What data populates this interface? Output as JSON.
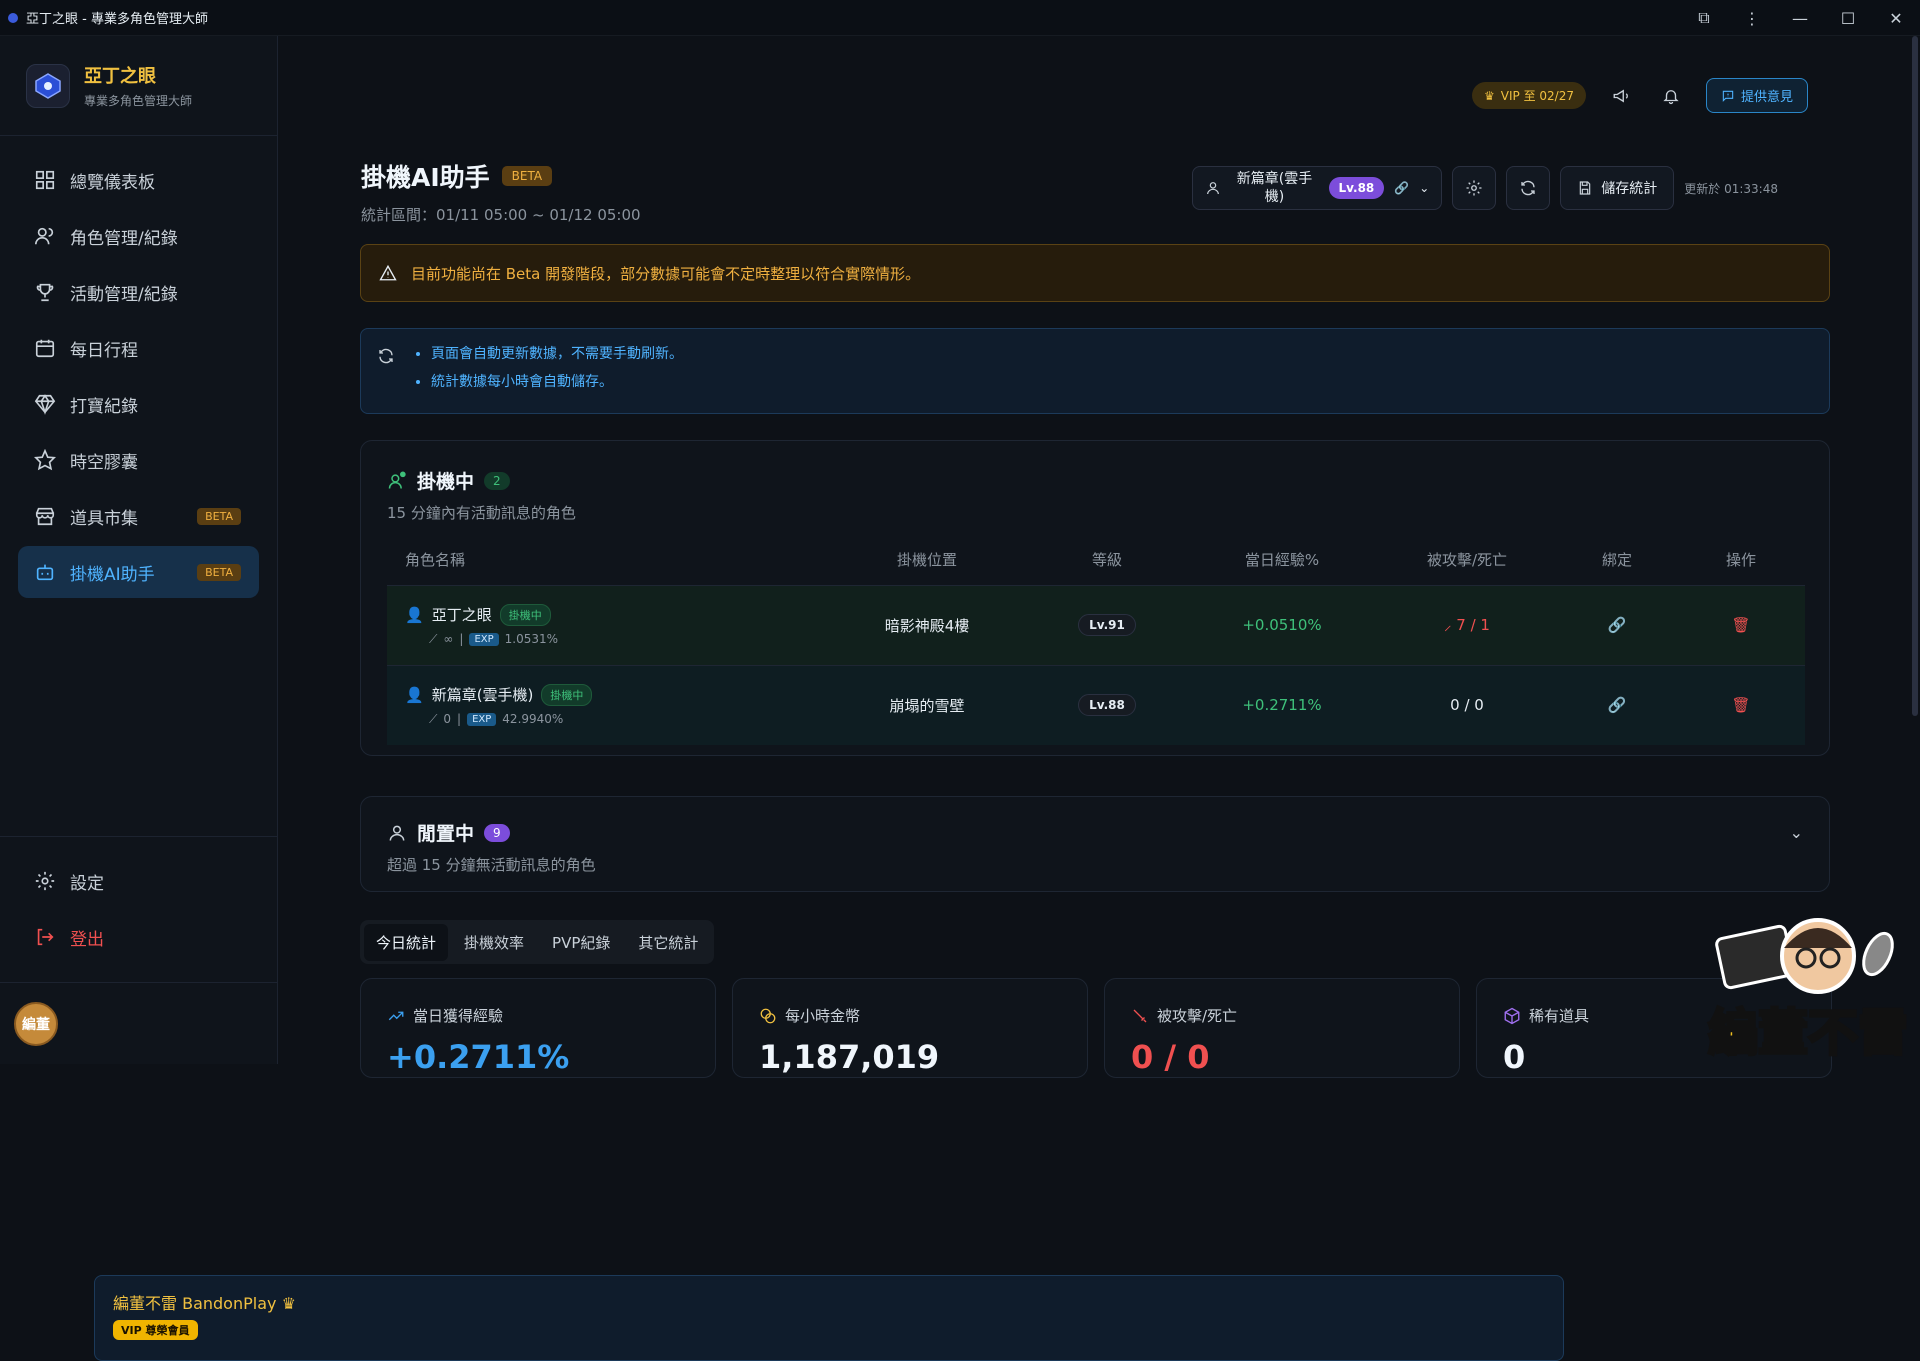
{
  "window": {
    "title": "亞丁之眼 - 專業多角色管理大師"
  },
  "brand": {
    "name": "亞丁之眼",
    "subtitle": "專業多角色管理大師"
  },
  "sidebar": {
    "items": [
      {
        "label": "總覽儀表板",
        "icon": "dashboard-icon"
      },
      {
        "label": "角色管理/紀錄",
        "icon": "users-icon"
      },
      {
        "label": "活動管理/紀錄",
        "icon": "trophy-icon"
      },
      {
        "label": "每日行程",
        "icon": "calendar-icon"
      },
      {
        "label": "打寶紀錄",
        "icon": "gem-icon"
      },
      {
        "label": "時空膠囊",
        "icon": "star-icon"
      },
      {
        "label": "道具市集",
        "icon": "store-icon",
        "badge": "BETA"
      },
      {
        "label": "掛機AI助手",
        "icon": "bot-icon",
        "badge": "BETA"
      }
    ],
    "settings": "設定",
    "logout": "登出"
  },
  "user": {
    "avatar_text": "編董",
    "name": "編董不雷 BandonPlay",
    "badge": "VIP 尊榮會員"
  },
  "topbar": {
    "vip": "VIP 至 02/27",
    "feedback": "提供意見"
  },
  "page": {
    "title": "掛機AI助手",
    "beta": "BETA",
    "period": "統計區間：01/11 05:00 ~ 01/12 05:00"
  },
  "toolbar": {
    "character": "新篇章(雲手機)",
    "character_level": "Lv.88",
    "save": "儲存統計",
    "updated": "更新於 01:33:48"
  },
  "warning": "目前功能尚在 Beta 開發階段，部分數據可能會不定時整理以符合實際情形。",
  "info": [
    "頁面會自動更新數據，不需要手動刷新。",
    "統計數據每小時會自動儲存。"
  ],
  "active": {
    "title": "掛機中",
    "count": "2",
    "subtitle": "15 分鐘內有活動訊息的角色",
    "columns": [
      "角色名稱",
      "掛機位置",
      "等級",
      "當日經驗%",
      "被攻擊/死亡",
      "綁定",
      "操作"
    ],
    "rows": [
      {
        "name": "亞丁之眼",
        "status": "掛機中",
        "feather": "∞",
        "exp": "1.0531%",
        "location": "暗影神殿4樓",
        "level": "Lv.91",
        "daily_exp": "+0.0510%",
        "attacked": "7 / 1"
      },
      {
        "name": "新篇章(雲手機)",
        "status": "掛機中",
        "feather": "0",
        "exp": "42.9940%",
        "location": "崩塌的雪壁",
        "level": "Lv.88",
        "daily_exp": "+0.2711%",
        "attacked": "0 / 0"
      }
    ]
  },
  "idle": {
    "title": "閒置中",
    "count": "9",
    "subtitle": "超過 15 分鐘無活動訊息的角色"
  },
  "tabs": [
    "今日統計",
    "掛機效率",
    "PVP紀錄",
    "其它統計"
  ],
  "stats": [
    {
      "label": "當日獲得經驗",
      "value": "+0.2711%",
      "color": "#3ba0f0"
    },
    {
      "label": "每小時金幣",
      "value": "1,187,019",
      "color": "#f0f6fc"
    },
    {
      "label": "被攻擊/死亡",
      "value": "0 / 0",
      "color": "#f05050"
    },
    {
      "label": "稀有道具",
      "value": "0",
      "color": "#f0f6fc"
    }
  ],
  "exp_tag": "EXP",
  "mascot": {
    "text": "編董不雷"
  }
}
